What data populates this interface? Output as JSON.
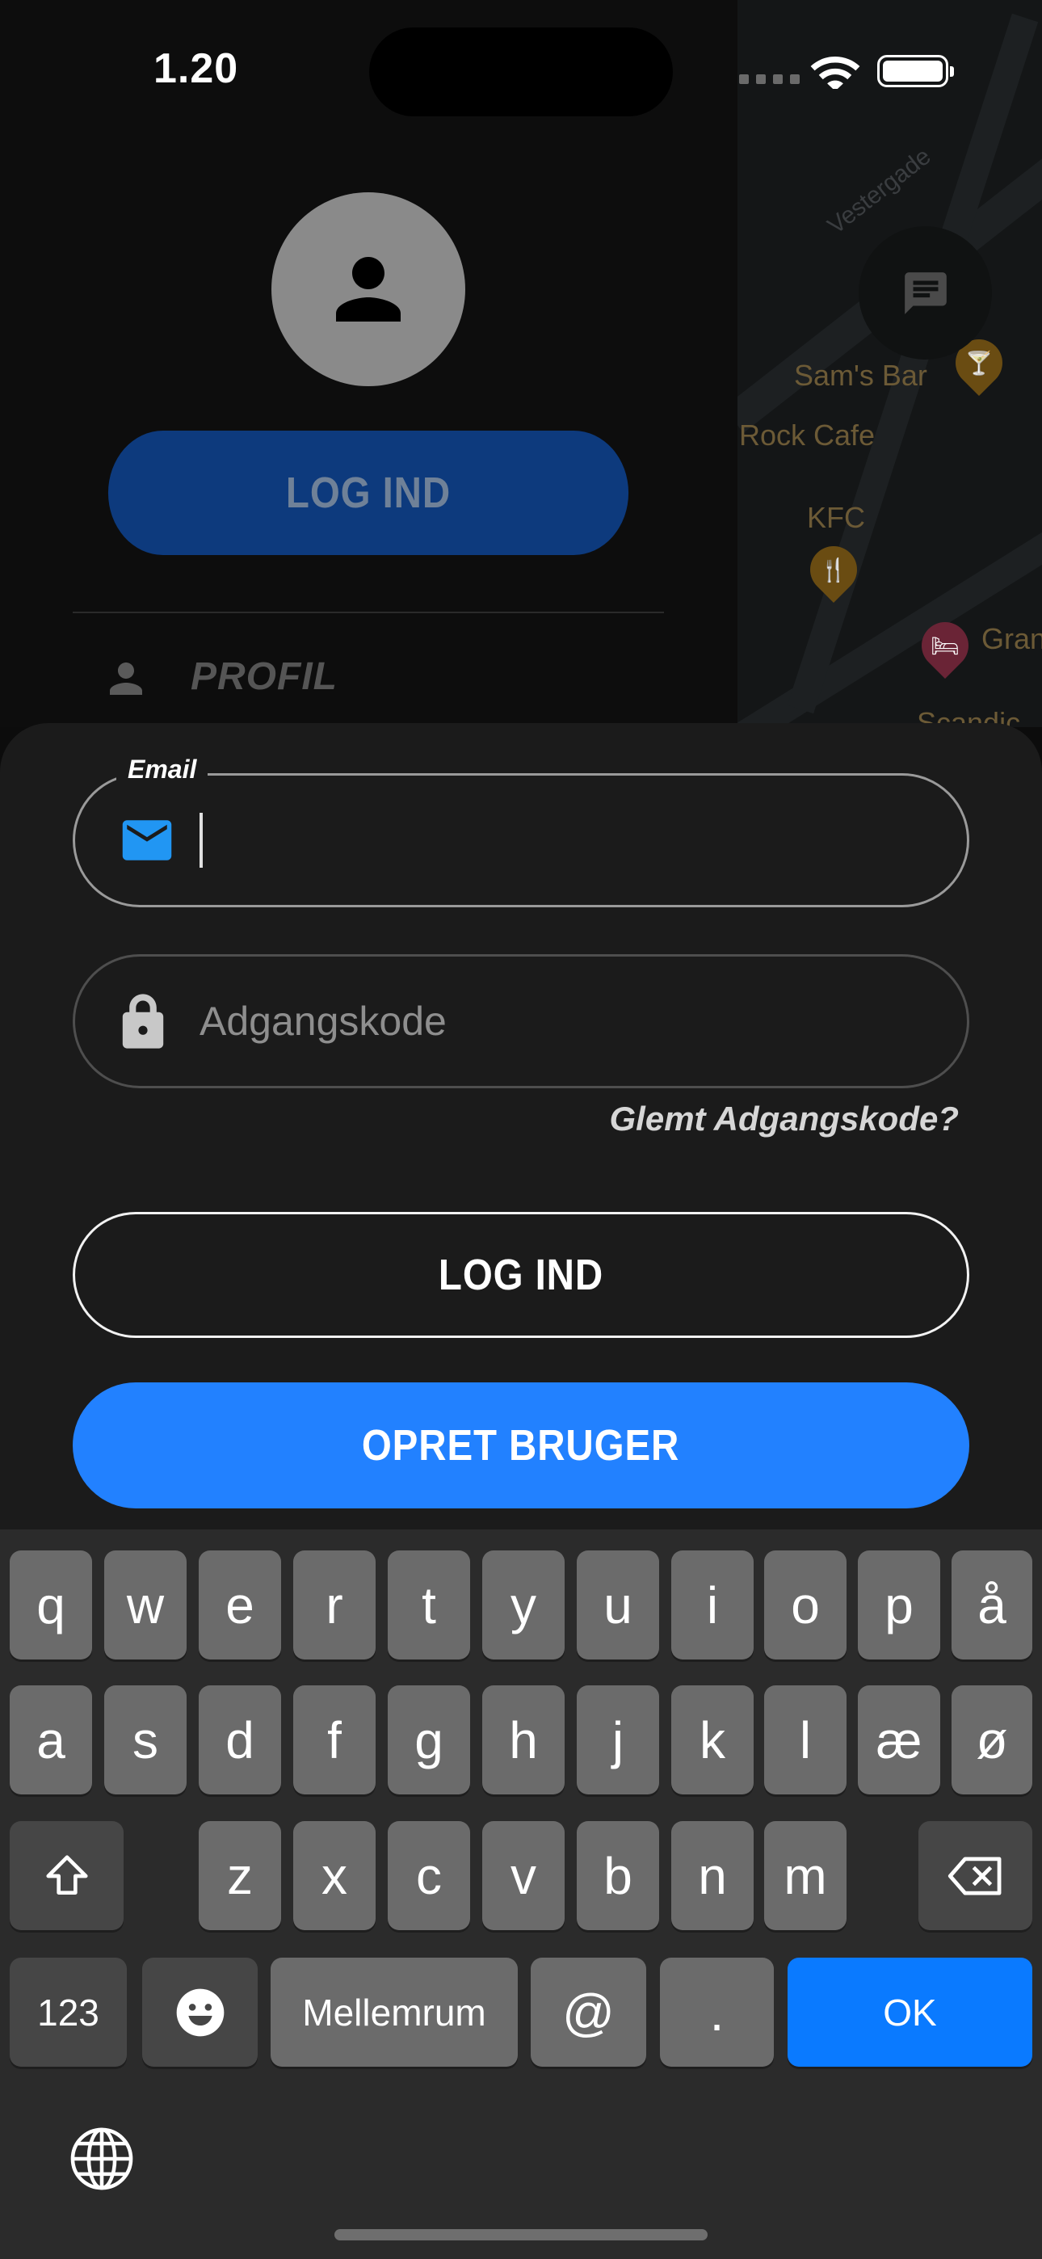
{
  "status_bar": {
    "time": "1.20"
  },
  "map": {
    "labels": [
      {
        "name": "sams-bar",
        "text": "Sam's Bar"
      },
      {
        "name": "rock-cafe",
        "text": "Rock Cafe"
      },
      {
        "name": "kfc",
        "text": "KFC"
      },
      {
        "name": "gran",
        "text": "Gran"
      },
      {
        "name": "scandic",
        "text": "Scandic"
      }
    ],
    "streets": [
      "Vestergade"
    ]
  },
  "drawer": {
    "login_label": "LOG IND",
    "profile_label": "PROFIL"
  },
  "login_form": {
    "email": {
      "legend": "Email",
      "value": ""
    },
    "password": {
      "placeholder": "Adgangskode",
      "value": ""
    },
    "forgot_label": "Glemt Adgangskode?",
    "login_label": "LOG IND",
    "create_user_label": "OPRET BRUGER"
  },
  "keyboard": {
    "row1": [
      "q",
      "w",
      "e",
      "r",
      "t",
      "y",
      "u",
      "i",
      "o",
      "p",
      "å"
    ],
    "row2": [
      "a",
      "s",
      "d",
      "f",
      "g",
      "h",
      "j",
      "k",
      "l",
      "æ",
      "ø"
    ],
    "row3": [
      "z",
      "x",
      "c",
      "v",
      "b",
      "n",
      "m"
    ],
    "numbers_label": "123",
    "space_label": "Mellemrum",
    "at_label": "@",
    "dot_label": ".",
    "ok_label": "OK"
  },
  "colors": {
    "accent": "#2281ff",
    "drawer_button": "#0d3a7d",
    "sheet": "#1b1b1b",
    "keyboard_blue": "#0a7aff"
  }
}
